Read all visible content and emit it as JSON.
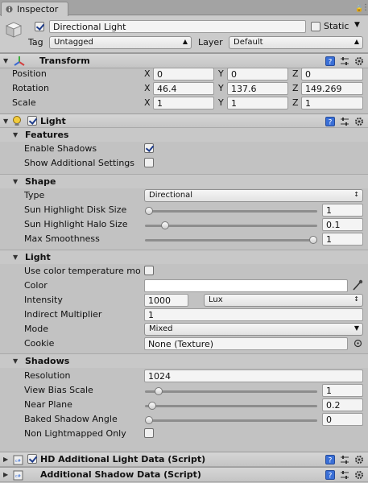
{
  "window": {
    "tab_label": "Inspector"
  },
  "object": {
    "active": true,
    "name": "Directional Light",
    "static_label": "Static",
    "static_checked": false,
    "tag_label": "Tag",
    "tag_value": "Untagged",
    "layer_label": "Layer",
    "layer_value": "Default"
  },
  "transform": {
    "title": "Transform",
    "rows": [
      {
        "label": "Position",
        "x": "0",
        "y": "0",
        "z": "0"
      },
      {
        "label": "Rotation",
        "x": "46.4",
        "y": "137.6",
        "z": "149.269"
      },
      {
        "label": "Scale",
        "x": "1",
        "y": "1",
        "z": "1"
      }
    ],
    "axis": {
      "x": "X",
      "y": "Y",
      "z": "Z"
    }
  },
  "light": {
    "title": "Light",
    "features": {
      "title": "Features",
      "enable_shadows_label": "Enable Shadows",
      "enable_shadows": true,
      "show_additional_label": "Show Additional Settings",
      "show_additional": false
    },
    "shape": {
      "title": "Shape",
      "type_label": "Type",
      "type_value": "Directional",
      "disk_label": "Sun Highlight Disk Size",
      "disk_value": "1",
      "disk_level": 0.0,
      "halo_label": "Sun Highlight Halo Size",
      "halo_value": "0.1",
      "halo_level": 0.1,
      "smooth_label": "Max Smoothness",
      "smooth_value": "1",
      "smooth_level": 1.0
    },
    "light_section": {
      "title": "Light",
      "temp_label": "Use color temperature mo",
      "temp_checked": false,
      "color_label": "Color",
      "color_value": "#ffffff",
      "intensity_label": "Intensity",
      "intensity_value": "1000",
      "intensity_unit": "Lux",
      "indirect_label": "Indirect Multiplier",
      "indirect_value": "1",
      "mode_label": "Mode",
      "mode_value": "Mixed",
      "cookie_label": "Cookie",
      "cookie_value": "None (Texture)"
    },
    "shadows": {
      "title": "Shadows",
      "resolution_label": "Resolution",
      "resolution_value": "1024",
      "bias_label": "View Bias Scale",
      "bias_value": "1",
      "bias_level": 0.06,
      "near_label": "Near Plane",
      "near_value": "0.2",
      "near_level": 0.02,
      "baked_label": "Baked Shadow Angle",
      "baked_value": "0",
      "baked_level": 0.0,
      "nonlm_label": "Non Lightmapped Only",
      "nonlm_checked": false
    }
  },
  "scripts": [
    {
      "title": "HD Additional Light Data (Script)",
      "enabled": true
    },
    {
      "title": "Additional Shadow Data (Script)"
    }
  ],
  "colors": {
    "accent_blue": "#3a6fd6",
    "panel": "#c2c2c2"
  }
}
